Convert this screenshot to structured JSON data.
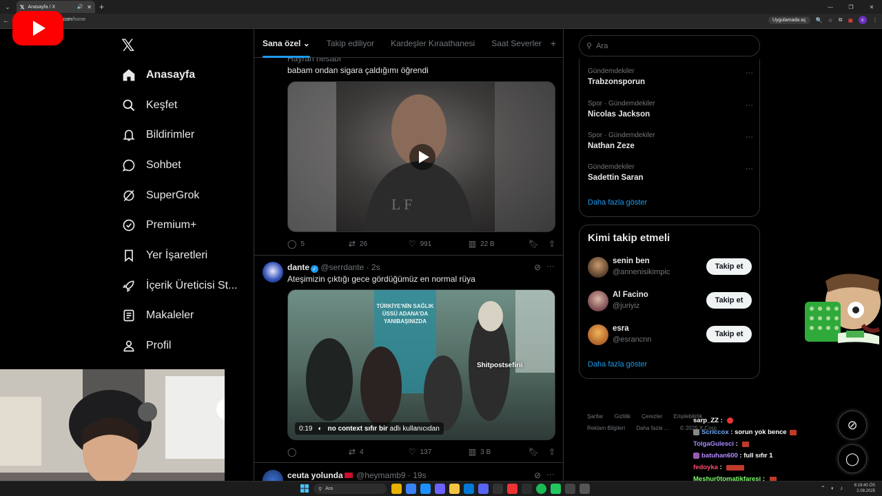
{
  "browser": {
    "tab_title": "Anasayfa / X",
    "url_host": "x.com",
    "url_path": "/home",
    "open_app_label": "Uygulamada aç",
    "profile_initial": "c"
  },
  "nav": {
    "items": [
      {
        "label": "Anasayfa",
        "icon": "home-icon"
      },
      {
        "label": "Keşfet",
        "icon": "search-icon"
      },
      {
        "label": "Bildirimler",
        "icon": "bell-icon"
      },
      {
        "label": "Sohbet",
        "icon": "chat-icon"
      },
      {
        "label": "SuperGrok",
        "icon": "grok-icon"
      },
      {
        "label": "Premium+",
        "icon": "verified-icon"
      },
      {
        "label": "Yer İşaretleri",
        "icon": "bookmark-icon"
      },
      {
        "label": "İçerik Üreticisi St...",
        "icon": "rocket-icon"
      },
      {
        "label": "Makaleler",
        "icon": "article-icon"
      },
      {
        "label": "Profil",
        "icon": "person-icon"
      }
    ],
    "more_label": "..."
  },
  "feed": {
    "tabs": [
      "Sana özel",
      "Takip ediliyor",
      "Kardeşler Kıraathanesi",
      "Saat Severler"
    ],
    "posts": [
      {
        "name": "Hayran hesabı",
        "text": "babam ondan sigara çaldığımı öğrendi",
        "replies": "5",
        "reposts": "26",
        "likes": "991",
        "views": "22 B"
      },
      {
        "name": "dante",
        "handle": "@serrdante",
        "time": "· 2s",
        "text": "Ateşimizin çıktığı gece gördüğümüz en normal rüya",
        "media_watermark": "Shitpostsefirii",
        "media_duration": "0:19",
        "media_caption_bold": "no context sıfır bir",
        "media_caption_rest": "adlı kullanıcıdan",
        "media_sign_text": "TÜRKİYE'NİN SAĞLIK ÜSSÜ ADANA'DA YANIBAŞINIZDA",
        "replies": "",
        "reposts": "4",
        "likes": "137",
        "views": "3 B"
      },
      {
        "name": "ceuta yolunda",
        "handle": "@heymamb9",
        "time": "· 19s"
      }
    ]
  },
  "right": {
    "search_placeholder": "Ara",
    "trends": [
      {
        "category": "Gündemdekiler",
        "name": "Trabzonsporun"
      },
      {
        "category": "Spor · Gündemdekiler",
        "name": "Nicolas Jackson"
      },
      {
        "category": "Spor · Gündemdekiler",
        "name": "Nathan Zeze"
      },
      {
        "category": "Gündemdekiler",
        "name": "Sadettin Saran"
      }
    ],
    "show_more": "Daha fazla göster",
    "who_to_follow_title": "Kimi takip etmeli",
    "suggestions": [
      {
        "name": "senin ben",
        "handle": "@annenisikimpic",
        "button": "Takip et"
      },
      {
        "name": "Al Facino",
        "handle": "@juriyiz",
        "button": "Takip et"
      },
      {
        "name": "esra",
        "handle": "@esrancnn",
        "button": "Takip et"
      }
    ],
    "footer_links": [
      "Şartlar",
      "Gizlilik",
      "Çerezler",
      "Erişilebilirlik",
      "Reklam Bilgileri",
      "Daha fazla ...",
      "© 2025 X Corp."
    ]
  },
  "chat": [
    {
      "user": "sarp_ZZ",
      "msg": "",
      "color": "#ffffff"
    },
    {
      "user": "Scriccox",
      "msg": "sorun yok bence",
      "color": "#6ea8ff"
    },
    {
      "user": "TolgaGulesci",
      "msg": "",
      "color": "#a78bff"
    },
    {
      "user": "batuhan600",
      "msg": "full sıfır 1",
      "color": "#b58cff"
    },
    {
      "user": "fedoyka",
      "msg": "",
      "color": "#ff4d6d"
    },
    {
      "user": "Meshur0tomatikfaresi",
      "msg": "",
      "color": "#7dff6b"
    }
  ],
  "taskbar": {
    "search_label": "Ara",
    "time": "6:19:40 ÖS",
    "date": "2.08.2025"
  }
}
